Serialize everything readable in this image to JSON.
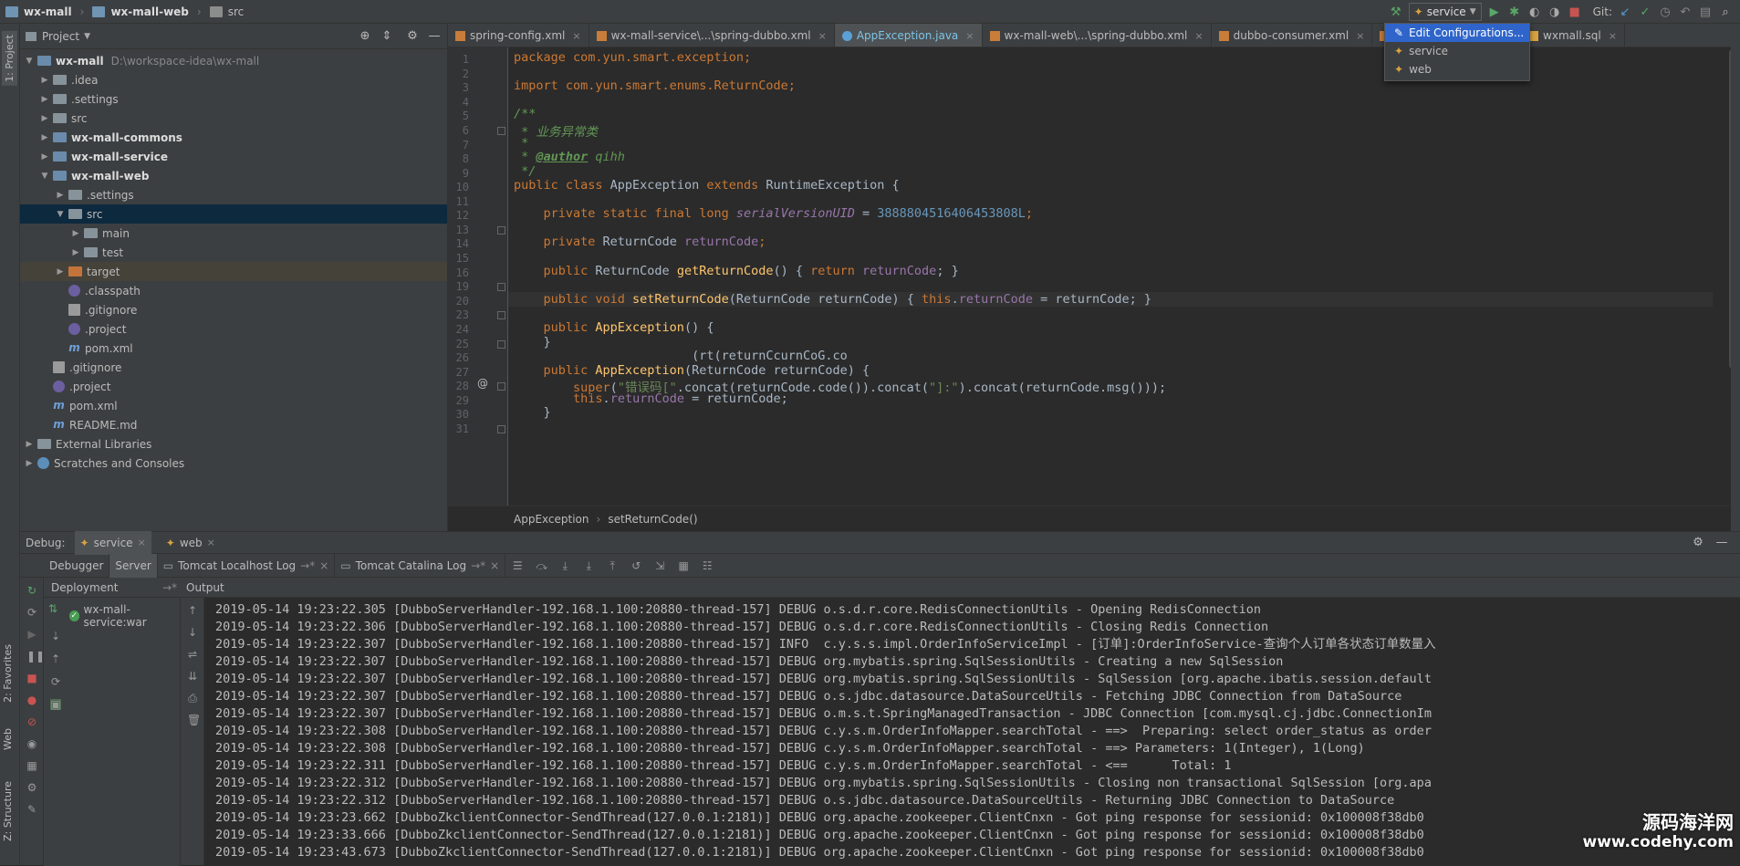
{
  "breadcrumb": [
    "wx-mall",
    "wx-mall-web",
    "src"
  ],
  "toolbar": {
    "run_config": "service",
    "git_label": "Git:"
  },
  "run_dropdown": {
    "items": [
      {
        "label": "Edit Configurations..."
      },
      {
        "label": "service"
      },
      {
        "label": "web"
      }
    ]
  },
  "project_panel": {
    "title": "Project",
    "tree": [
      {
        "label": "wx-mall",
        "path": "D:\\workspace-idea\\wx-mall",
        "depth": 0,
        "arrow": "down",
        "icon": "module",
        "bold": true
      },
      {
        "label": ".idea",
        "depth": 1,
        "arrow": "right",
        "icon": "folder"
      },
      {
        "label": ".settings",
        "depth": 1,
        "arrow": "right",
        "icon": "folder"
      },
      {
        "label": "src",
        "depth": 1,
        "arrow": "right",
        "icon": "folder"
      },
      {
        "label": "wx-mall-commons",
        "depth": 1,
        "arrow": "right",
        "icon": "module",
        "bold": true
      },
      {
        "label": "wx-mall-service",
        "depth": 1,
        "arrow": "right",
        "icon": "module",
        "bold": true
      },
      {
        "label": "wx-mall-web",
        "depth": 1,
        "arrow": "down",
        "icon": "module",
        "bold": true
      },
      {
        "label": ".settings",
        "depth": 2,
        "arrow": "right",
        "icon": "folder"
      },
      {
        "label": "src",
        "depth": 2,
        "arrow": "down",
        "icon": "folder",
        "selected": true
      },
      {
        "label": "main",
        "depth": 3,
        "arrow": "right",
        "icon": "folder"
      },
      {
        "label": "test",
        "depth": 3,
        "arrow": "right",
        "icon": "folder"
      },
      {
        "label": "target",
        "depth": 2,
        "arrow": "right",
        "icon": "folder-orange",
        "highlight": true
      },
      {
        "label": ".classpath",
        "depth": 2,
        "arrow": "",
        "icon": "file"
      },
      {
        "label": ".gitignore",
        "depth": 2,
        "arrow": "",
        "icon": "gitfile"
      },
      {
        "label": ".project",
        "depth": 2,
        "arrow": "",
        "icon": "file"
      },
      {
        "label": "pom.xml",
        "depth": 2,
        "arrow": "",
        "icon": "maven"
      },
      {
        "label": ".gitignore",
        "depth": 1,
        "arrow": "",
        "icon": "gitfile"
      },
      {
        "label": ".project",
        "depth": 1,
        "arrow": "",
        "icon": "file"
      },
      {
        "label": "pom.xml",
        "depth": 1,
        "arrow": "",
        "icon": "maven"
      },
      {
        "label": "README.md",
        "depth": 1,
        "arrow": "",
        "icon": "maven"
      },
      {
        "label": "External Libraries",
        "depth": 0,
        "arrow": "right",
        "icon": "library"
      },
      {
        "label": "Scratches and Consoles",
        "depth": 0,
        "arrow": "right",
        "icon": "scratch"
      }
    ]
  },
  "side_tabs": {
    "project": "1: Project",
    "favorites": "2: Favorites",
    "web": "Web",
    "structure": "Z: Structure"
  },
  "editor": {
    "tabs": [
      {
        "label": "spring-config.xml",
        "active": false
      },
      {
        "label": "wx-mall-service\\...\\spring-dubbo.xml",
        "active": false
      },
      {
        "label": "AppException.java",
        "active": true
      },
      {
        "label": "wx-mall-web\\...\\spring-dubbo.xml",
        "active": false
      },
      {
        "label": "dubbo-consumer.xml",
        "active": false
      },
      {
        "label": "d",
        "active": false
      },
      {
        "label": "wxmall.sql",
        "active": false
      }
    ],
    "line_numbers": [
      "1",
      "2",
      "3",
      "4",
      "5",
      "6",
      "7",
      "8",
      "9",
      "10",
      "11",
      "12",
      "13",
      "14",
      "15",
      "16",
      "19",
      "20",
      "23",
      "24",
      "25",
      "26",
      "27",
      "28",
      "29",
      "30",
      "31"
    ],
    "code": {
      "l1": "package com.yun.smart.exception;",
      "l3": "import com.yun.smart.enums.ReturnCode;",
      "l5": "/**",
      "l6": " * 业务异常类",
      "l7": " *",
      "l8_prefix": " * ",
      "l8_tag": "@author",
      "l8_name": " qihh",
      "l9": " */",
      "l10_a": "public class ",
      "l10_b": "AppException ",
      "l10_c": "extends ",
      "l10_d": "RuntimeException {",
      "l12_kw": "    private static final long ",
      "l12_fld": "serialVersionUID",
      "l12_eq": " = ",
      "l12_num": "3888804516406453808L",
      "l12_end": ";",
      "l14_kw": "    private ",
      "l14_type": "ReturnCode ",
      "l14_fld": "returnCode",
      "l14_end": ";",
      "l16_kw": "    public ",
      "l16_type": "ReturnCode ",
      "l16_fn": "getReturnCode",
      "l16_mid": "() { ",
      "l16_ret": "return ",
      "l16_fld": "returnCode",
      "l16_end": "; }",
      "l20_kw": "    public void ",
      "l20_fn": "setReturnCode",
      "l20_mid": "(ReturnCode returnCode) { ",
      "l20_this": "this",
      "l20_dot": ".",
      "l20_fld": "returnCode",
      "l20_end": " = returnCode; }",
      "l24_kw": "    public ",
      "l24_fn": "AppException",
      "l24_end": "() {",
      "l25": "    }",
      "l26": "                        (rt(returnCcurnCoG.co",
      "l27_kw": "    public ",
      "l27_fn": "AppException",
      "l27_end": "(ReturnCode returnCode) {",
      "l28_kw": "        super",
      "l28_a": "(",
      "l28_s1": "\"错误码[\"",
      "l28_b": ".concat(returnCode.code()).concat(",
      "l28_s2": "\"]:\"",
      "l28_c": ").concat(returnCode.msg()));",
      "l29_kw": "        this",
      "l29_dot": ".",
      "l29_fld": "returnCode",
      "l29_end": " = returnCode;",
      "l30": "    }"
    },
    "breadcrumb": [
      "AppException",
      "setReturnCode()"
    ]
  },
  "debug": {
    "label": "Debug:",
    "sessions": [
      {
        "label": "service",
        "active": true
      },
      {
        "label": "web",
        "active": false
      }
    ],
    "tabs": [
      {
        "label": "Debugger",
        "active": false
      },
      {
        "label": "Server",
        "active": true
      },
      {
        "label": "Tomcat Localhost Log",
        "active": false
      },
      {
        "label": "Tomcat Catalina Log",
        "active": false
      }
    ],
    "deployment_header": "Deployment",
    "output_header": "Output",
    "deployment_item": "wx-mall-service:war",
    "log_lines": [
      "2019-05-14 19:23:22.305 [DubboServerHandler-192.168.1.100:20880-thread-157] DEBUG o.s.d.r.core.RedisConnectionUtils - Opening RedisConnection",
      "2019-05-14 19:23:22.306 [DubboServerHandler-192.168.1.100:20880-thread-157] DEBUG o.s.d.r.core.RedisConnectionUtils - Closing Redis Connection",
      "2019-05-14 19:23:22.307 [DubboServerHandler-192.168.1.100:20880-thread-157] INFO  c.y.s.s.impl.OrderInfoServiceImpl - [订单]:OrderInfoService-查询个人订单各状态订单数量入",
      "2019-05-14 19:23:22.307 [DubboServerHandler-192.168.1.100:20880-thread-157] DEBUG org.mybatis.spring.SqlSessionUtils - Creating a new SqlSession",
      "2019-05-14 19:23:22.307 [DubboServerHandler-192.168.1.100:20880-thread-157] DEBUG org.mybatis.spring.SqlSessionUtils - SqlSession [org.apache.ibatis.session.default",
      "2019-05-14 19:23:22.307 [DubboServerHandler-192.168.1.100:20880-thread-157] DEBUG o.s.jdbc.datasource.DataSourceUtils - Fetching JDBC Connection from DataSource",
      "2019-05-14 19:23:22.307 [DubboServerHandler-192.168.1.100:20880-thread-157] DEBUG o.m.s.t.SpringManagedTransaction - JDBC Connection [com.mysql.cj.jdbc.ConnectionIm",
      "2019-05-14 19:23:22.308 [DubboServerHandler-192.168.1.100:20880-thread-157] DEBUG c.y.s.m.OrderInfoMapper.searchTotal - ==>  Preparing: select order_status as order",
      "2019-05-14 19:23:22.308 [DubboServerHandler-192.168.1.100:20880-thread-157] DEBUG c.y.s.m.OrderInfoMapper.searchTotal - ==> Parameters: 1(Integer), 1(Long)",
      "2019-05-14 19:23:22.311 [DubboServerHandler-192.168.1.100:20880-thread-157] DEBUG c.y.s.m.OrderInfoMapper.searchTotal - <==      Total: 1",
      "2019-05-14 19:23:22.312 [DubboServerHandler-192.168.1.100:20880-thread-157] DEBUG org.mybatis.spring.SqlSessionUtils - Closing non transactional SqlSession [org.apa",
      "2019-05-14 19:23:22.312 [DubboServerHandler-192.168.1.100:20880-thread-157] DEBUG o.s.jdbc.datasource.DataSourceUtils - Returning JDBC Connection to DataSource",
      "2019-05-14 19:23:23.662 [DubboZkclientConnector-SendThread(127.0.0.1:2181)] DEBUG org.apache.zookeeper.ClientCnxn - Got ping response for sessionid: 0x100008f38db0",
      "2019-05-14 19:23:33.666 [DubboZkclientConnector-SendThread(127.0.0.1:2181)] DEBUG org.apache.zookeeper.ClientCnxn - Got ping response for sessionid: 0x100008f38db0",
      "2019-05-14 19:23:43.673 [DubboZkclientConnector-SendThread(127.0.0.1:2181)] DEBUG org.apache.zookeeper.ClientCnxn - Got ping response for sessionid: 0x100008f38db0"
    ]
  },
  "watermark": {
    "line1": "源码海洋网",
    "line2": "www.codehy.com"
  }
}
